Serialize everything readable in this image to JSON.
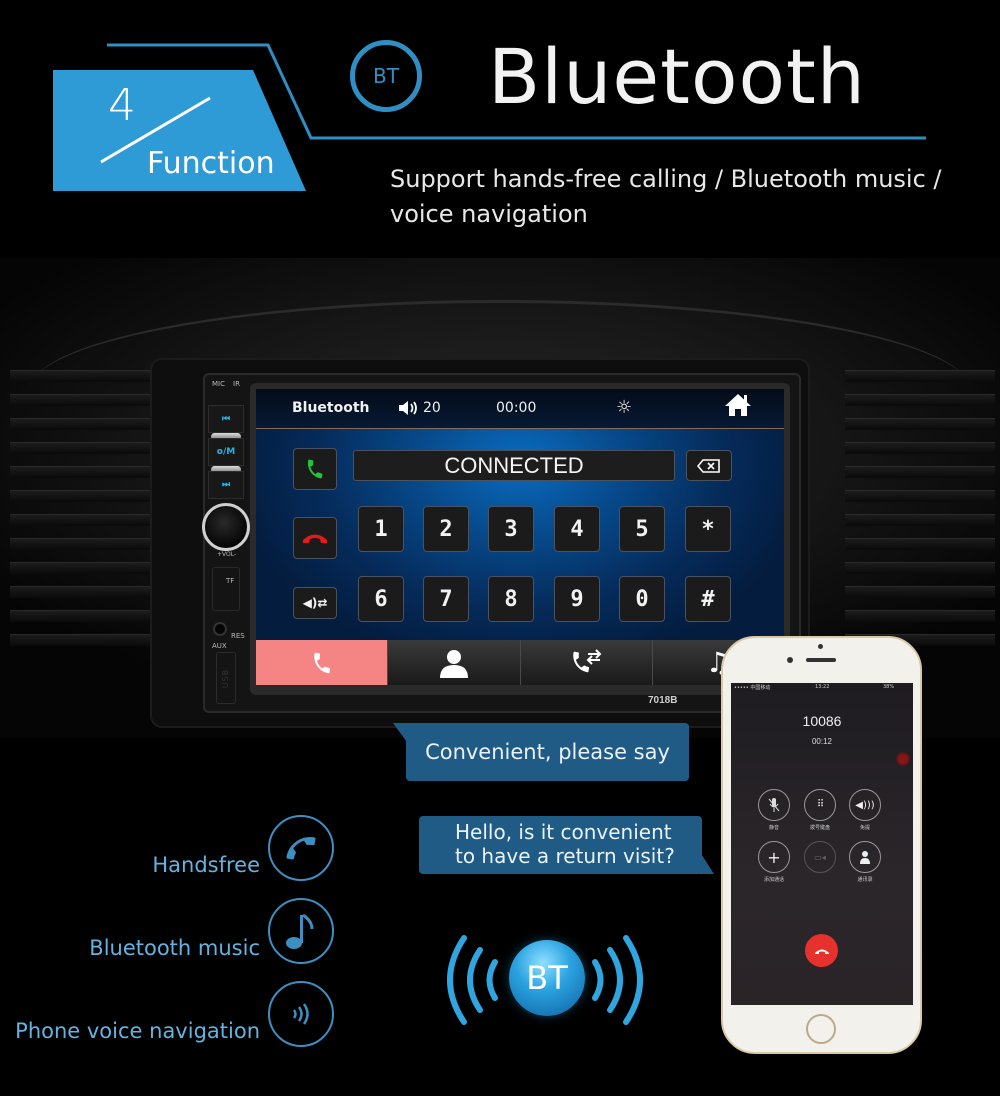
{
  "header": {
    "function_number": "4",
    "function_label": "Function",
    "bt_badge": "BT",
    "title": "Bluetooth",
    "subtitle": "Support hands-free calling / Bluetooth music / voice navigation",
    "accent_color": "#2f8fc4"
  },
  "head_unit": {
    "side_labels": {
      "mic": "MIC",
      "ir": "IR",
      "mode": "o/M",
      "vol": "+VOL-",
      "tf": "TF",
      "res": "RES",
      "aux": "AUX",
      "usb": "USB"
    },
    "model": "7018B",
    "status_bar": {
      "title": "Bluetooth",
      "volume_icon": "speaker-icon",
      "volume": "20",
      "time": "00:00",
      "brightness_icon": "sun-icon",
      "home_icon": "home-icon"
    },
    "display_text": "CONNECTED",
    "left_buttons": [
      {
        "name": "call-answer",
        "icon": "phone-green-icon"
      },
      {
        "name": "call-hangup",
        "icon": "phone-red-icon"
      },
      {
        "name": "audio-switch",
        "icon": "speaker-switch-icon"
      }
    ],
    "keypad_row1": [
      "1",
      "2",
      "3",
      "4",
      "5",
      "*"
    ],
    "keypad_row2": [
      "6",
      "7",
      "8",
      "9",
      "0",
      "#"
    ],
    "backspace_icon": "backspace-icon",
    "bottom_tabs": [
      {
        "icon": "phone-icon",
        "active": true
      },
      {
        "icon": "contacts-icon",
        "active": false
      },
      {
        "icon": "call-log-icon",
        "active": false
      },
      {
        "icon": "music-icon",
        "active": false
      }
    ],
    "active_tab_color": "#f58585"
  },
  "chat": {
    "bubble1": "Convenient, please say",
    "bubble2_line1": "Hello, is it convenient",
    "bubble2_line2": "to have a return visit?",
    "bubble_color": "#1f5b85"
  },
  "features": [
    {
      "label": "Handsfree",
      "icon": "handset-icon"
    },
    {
      "label": "Bluetooth music",
      "icon": "music-note-icon"
    },
    {
      "label": "Phone voice navigation",
      "icon": "sound-waves-icon"
    }
  ],
  "bt_logo": "BT",
  "phone": {
    "status_carrier": "••••• 中国移动",
    "status_time": "13:22",
    "status_battery": "38%",
    "call_number": "10086",
    "call_duration": "00:12",
    "buttons": [
      {
        "label": "静音",
        "icon": "mute-icon"
      },
      {
        "label": "拨号键盘",
        "icon": "keypad-icon"
      },
      {
        "label": "免提",
        "icon": "speaker-icon"
      },
      {
        "label": "添加通话",
        "icon": "add-call-icon"
      },
      {
        "label": "",
        "icon": "facetime-icon"
      },
      {
        "label": "通讯录",
        "icon": "contacts-icon"
      }
    ],
    "end_call_color": "#e7312c"
  }
}
